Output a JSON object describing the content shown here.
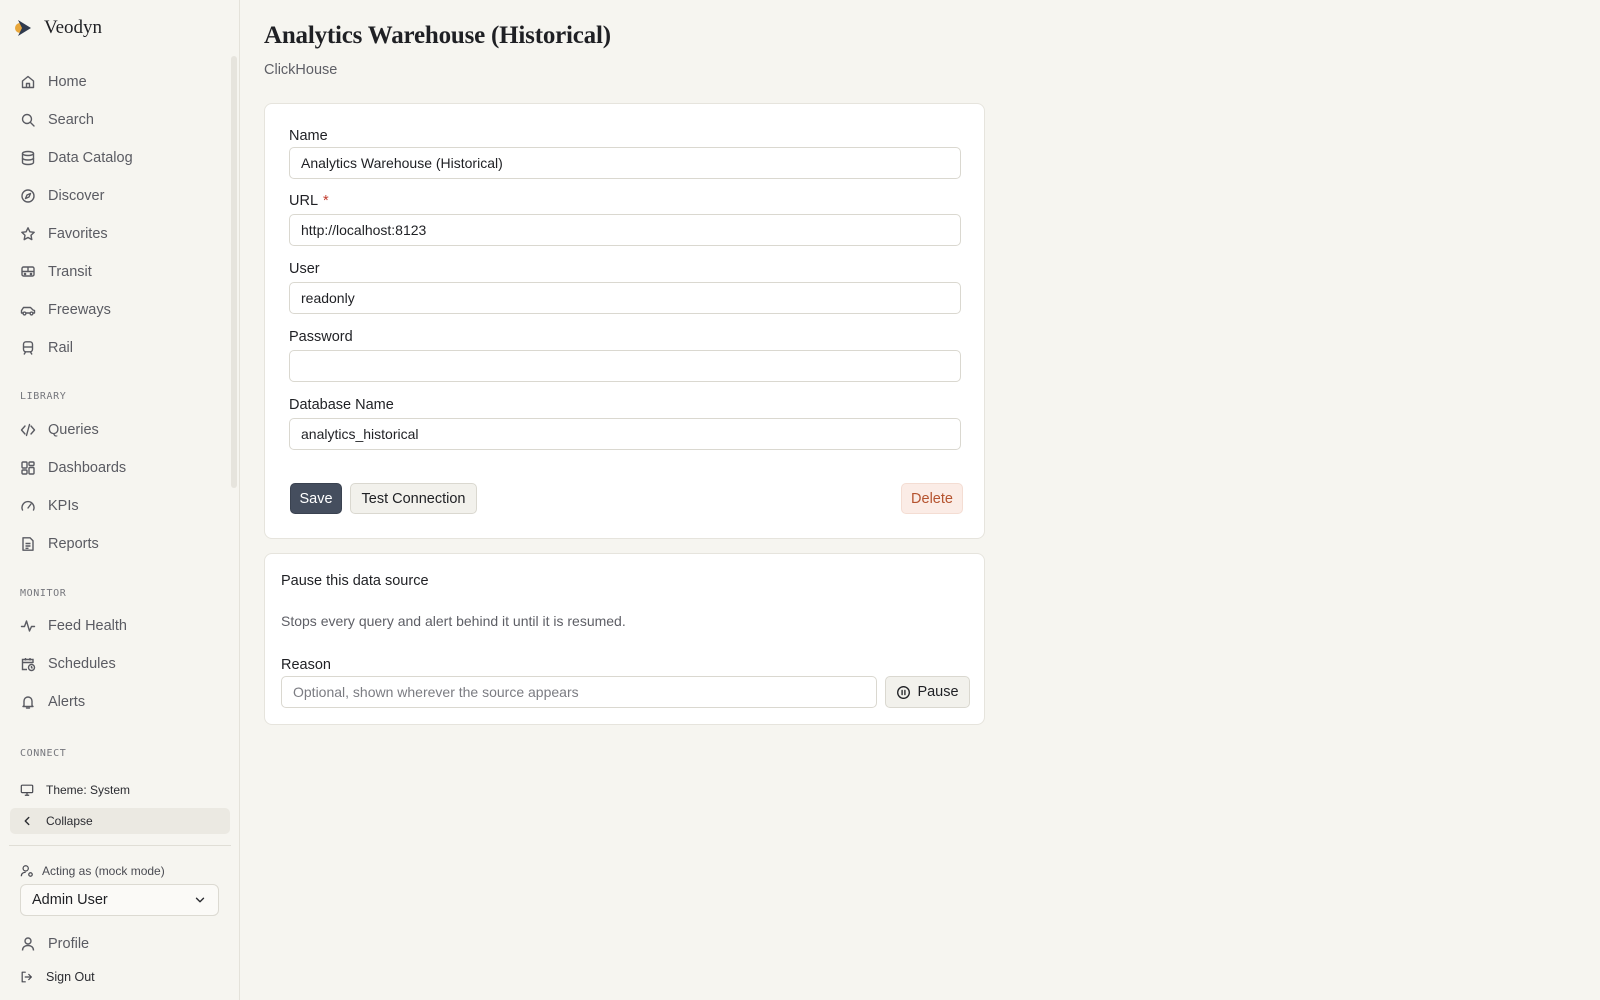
{
  "brand": {
    "name": "Veodyn",
    "logo_colors": [
      "#2f3a4e",
      "#e8a63a"
    ]
  },
  "sidebar": {
    "main_items": [
      {
        "label": "Home",
        "icon": "home-icon"
      },
      {
        "label": "Search",
        "icon": "search-icon"
      },
      {
        "label": "Data Catalog",
        "icon": "database-icon"
      },
      {
        "label": "Discover",
        "icon": "compass-icon"
      },
      {
        "label": "Favorites",
        "icon": "star-icon"
      },
      {
        "label": "Transit",
        "icon": "bus-icon"
      },
      {
        "label": "Freeways",
        "icon": "car-icon"
      },
      {
        "label": "Rail",
        "icon": "train-icon"
      }
    ],
    "library_label": "LIBRARY",
    "library_items": [
      {
        "label": "Queries",
        "icon": "code-icon"
      },
      {
        "label": "Dashboards",
        "icon": "dashboard-icon"
      },
      {
        "label": "KPIs",
        "icon": "gauge-icon"
      },
      {
        "label": "Reports",
        "icon": "report-icon"
      }
    ],
    "monitor_label": "MONITOR",
    "monitor_items": [
      {
        "label": "Feed Health",
        "icon": "activity-icon"
      },
      {
        "label": "Schedules",
        "icon": "calendar-clock-icon"
      },
      {
        "label": "Alerts",
        "icon": "bell-icon"
      }
    ],
    "connect_label": "CONNECT",
    "theme_label": "Theme: System",
    "collapse_label": "Collapse",
    "acting_as_label": "Acting as (mock mode)",
    "acting_as_value": "Admin User",
    "profile_label": "Profile",
    "signout_label": "Sign Out"
  },
  "page": {
    "title": "Analytics Warehouse (Historical)",
    "subtitle": "ClickHouse"
  },
  "form": {
    "name_label": "Name",
    "name_value": "Analytics Warehouse (Historical)",
    "url_label": "URL",
    "url_required_mark": "*",
    "url_value": "http://localhost:8123",
    "user_label": "User",
    "user_value": "readonly",
    "password_label": "Password",
    "password_value": "",
    "database_label": "Database Name",
    "database_value": "analytics_historical",
    "save_label": "Save",
    "test_label": "Test Connection",
    "delete_label": "Delete"
  },
  "pause": {
    "title": "Pause this data source",
    "description": "Stops every query and alert behind it until it is resumed.",
    "reason_label": "Reason",
    "reason_placeholder": "Optional, shown wherever the source appears",
    "reason_value": "",
    "button_label": "Pause"
  },
  "colors": {
    "background": "#f6f5f0",
    "primary_button": "#454e5e",
    "danger_text": "#b5532f",
    "danger_bg": "#fbece6",
    "required": "#c0392b"
  }
}
